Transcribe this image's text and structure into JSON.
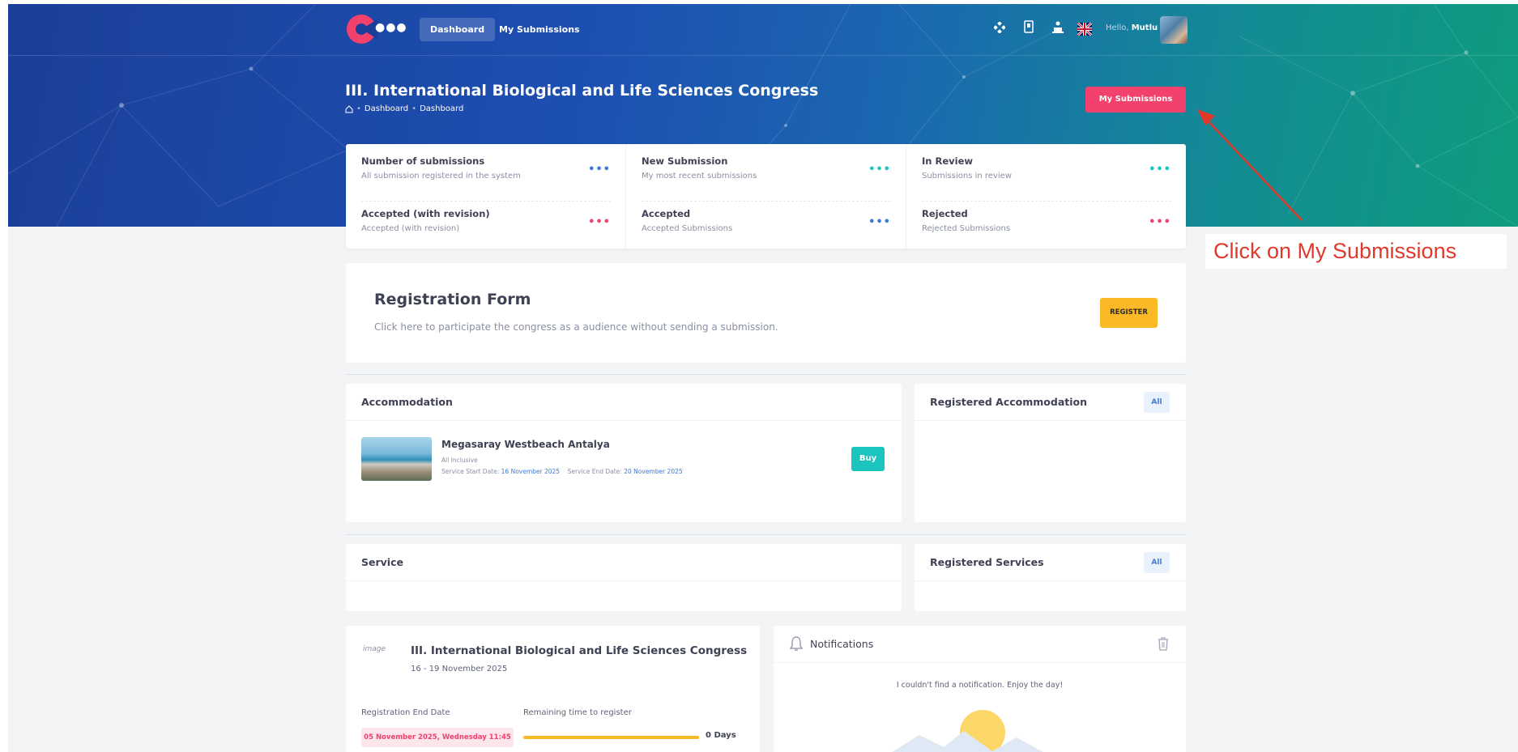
{
  "nav": {
    "items": [
      {
        "label": "Dashboard",
        "active": true
      },
      {
        "label": "My Submissions",
        "active": false
      }
    ],
    "hello": "Hello,",
    "user": "Mutlu",
    "icons": [
      "apps-icon",
      "reader-icon",
      "speaker-icon",
      "uk-flag-icon"
    ]
  },
  "header": {
    "title": "III. International Biological and Life Sciences Congress",
    "breadcrumb": [
      "Dashboard",
      "Dashboard"
    ],
    "action": "My Submissions"
  },
  "stats": [
    {
      "title": "Number of submissions",
      "subtitle": "All submission registered in the system",
      "dot_color": "#3e7ad8"
    },
    {
      "title": "New Submission",
      "subtitle": "My most recent submissions",
      "dot_color": "#1bc5bd"
    },
    {
      "title": "In Review",
      "subtitle": "Submissions in review",
      "dot_color": "#1bc5bd"
    },
    {
      "title": "Accepted (with revision)",
      "subtitle": "Accepted (with revision)",
      "dot_color": "#f1416c"
    },
    {
      "title": "Accepted",
      "subtitle": "Accepted Submissions",
      "dot_color": "#3e7ad8"
    },
    {
      "title": "Rejected",
      "subtitle": "Rejected Submissions",
      "dot_color": "#f1416c"
    }
  ],
  "dots": "•••",
  "registration": {
    "title": "Registration Form",
    "description": "Click here to participate the congress as a audience without sending a submission.",
    "button": "REGISTER"
  },
  "accommodation": {
    "title": "Accommodation",
    "hotel": {
      "name": "Megasaray Westbeach Antalya",
      "board": "All Inclusive",
      "start_label": "Service Start Date:",
      "start": "16 November 2025",
      "end_label": "Service End Date:",
      "end": "20 November 2025",
      "button": "Buy"
    }
  },
  "registered_accommodation": {
    "title": "Registered Accommodation",
    "button": "All"
  },
  "service": {
    "title": "Service"
  },
  "registered_services": {
    "title": "Registered Services",
    "button": "All"
  },
  "congress": {
    "logo_alt": "image",
    "title": "III. International Biological and Life Sciences Congress",
    "dates": "16 - 19 November 2025",
    "end_label": "Registration End Date",
    "end_value": "05 November 2025, Wednesday 11:45",
    "remaining_label": "Remaining time to register",
    "remaining_value": "0 Days",
    "remaining_fraction": 1.0
  },
  "notifications": {
    "title": "Notifications",
    "empty": "I couldn't find a notification. Enjoy the day!"
  },
  "annotation": {
    "text": "Click on My Submissions",
    "color": "#e0392b"
  },
  "colors": {
    "primary_pink": "#f1416c",
    "register_yellow": "#fbb827",
    "buy_teal": "#1bc5bd",
    "link_blue": "#3e7ad8"
  }
}
